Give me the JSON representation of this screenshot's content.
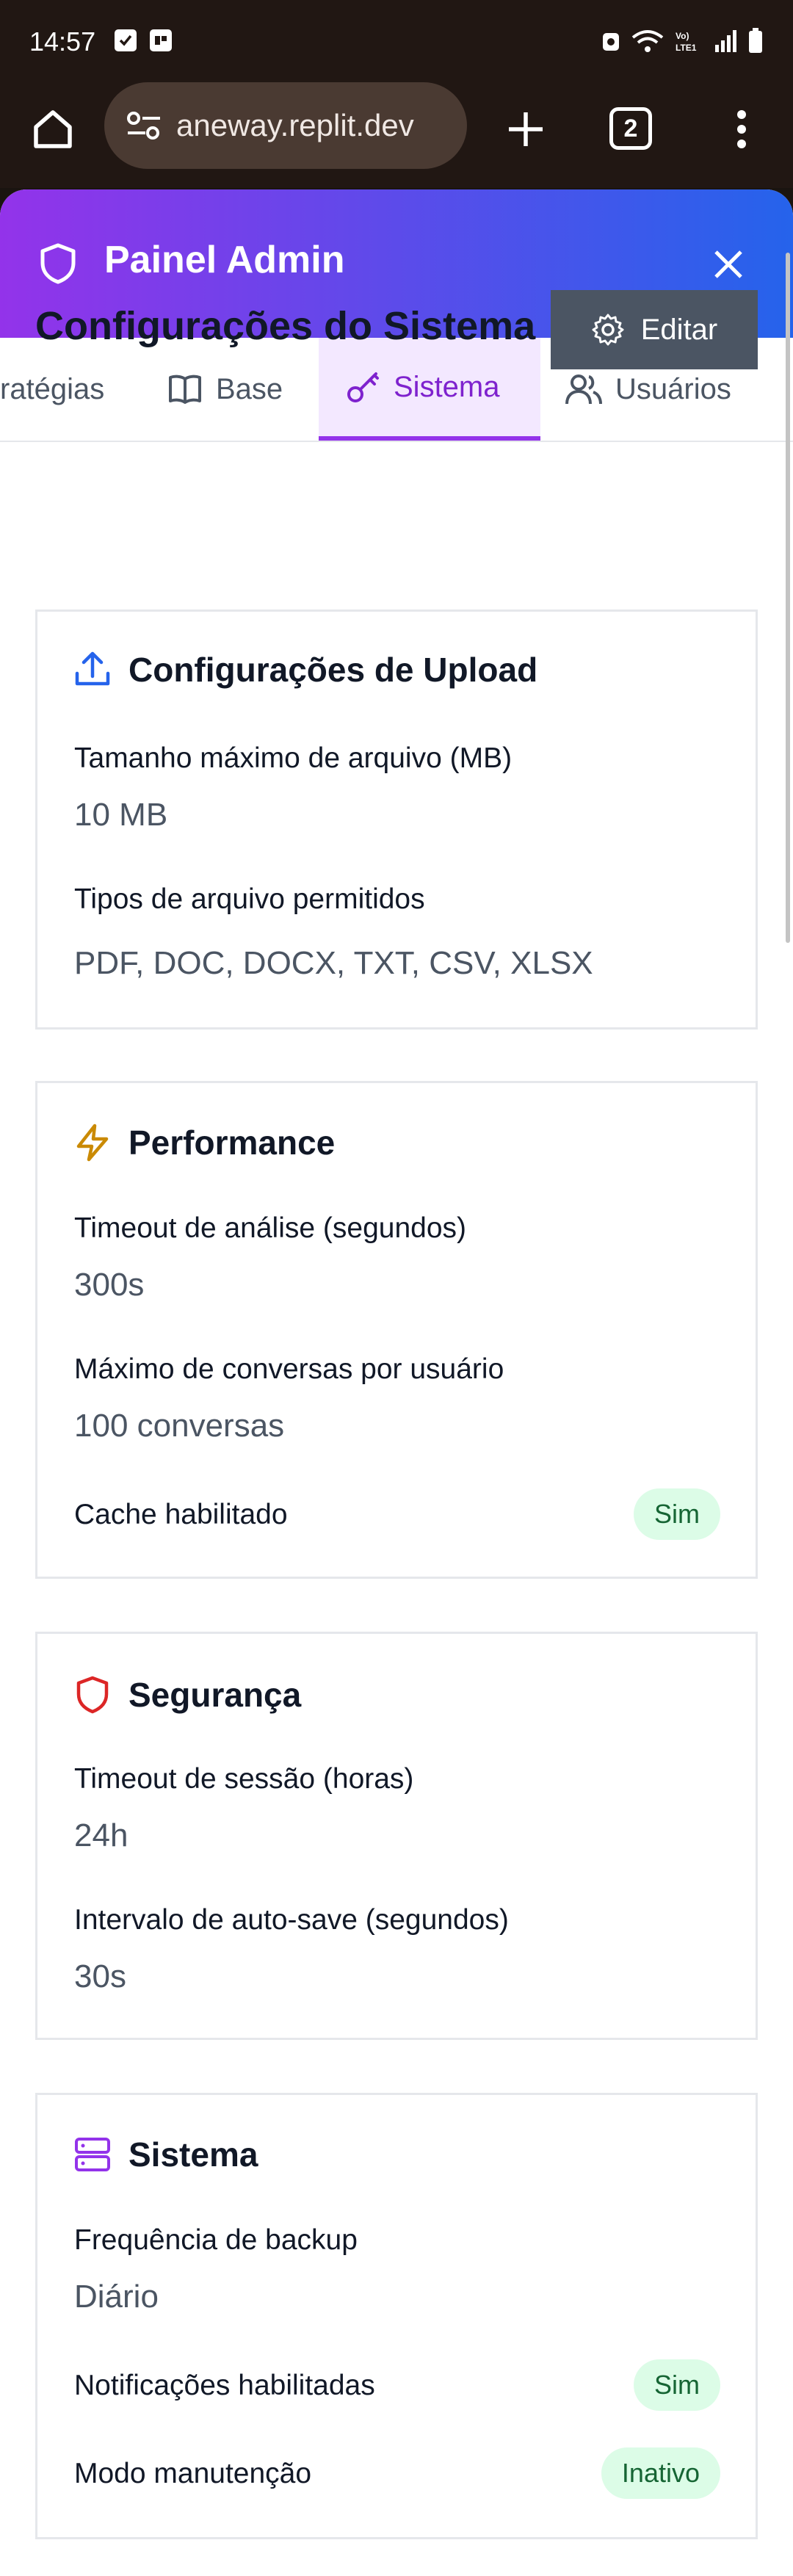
{
  "status_bar": {
    "time": "14:57"
  },
  "browser": {
    "url": "aneway.replit.dev",
    "tab_count": "2"
  },
  "modal": {
    "title": "Painel Admin",
    "tabs": [
      {
        "label": "ratégias"
      },
      {
        "label": "Base"
      },
      {
        "label": "Sistema"
      },
      {
        "label": "Usuários"
      }
    ],
    "page_title": "Configurações do Sistema",
    "edit_label": "Editar"
  },
  "cards": {
    "upload": {
      "title": "Configurações de Upload",
      "max_size_label": "Tamanho máximo de arquivo (MB)",
      "max_size_value": "10 MB",
      "types_label": "Tipos de arquivo permitidos",
      "types_value": "PDF, DOC, DOCX, TXT, CSV, XLSX"
    },
    "performance": {
      "title": "Performance",
      "timeout_label": "Timeout de análise (segundos)",
      "timeout_value": "300s",
      "max_conv_label": "Máximo de conversas por usuário",
      "max_conv_value": "100 conversas",
      "cache_label": "Cache habilitado",
      "cache_value": "Sim"
    },
    "security": {
      "title": "Segurança",
      "session_label": "Timeout de sessão (horas)",
      "session_value": "24h",
      "autosave_label": "Intervalo de auto-save (segundos)",
      "autosave_value": "30s"
    },
    "system": {
      "title": "Sistema",
      "backup_label": "Frequência de backup",
      "backup_value": "Diário",
      "notif_label": "Notificações habilitadas",
      "notif_value": "Sim",
      "maint_label": "Modo manutenção",
      "maint_value": "Inativo"
    }
  },
  "colors": {
    "header_gradient_start": "#9333ea",
    "header_gradient_end": "#2563eb",
    "active_tab": "#9333ea",
    "badge_bg": "#dcfce7",
    "badge_text": "#166534",
    "edit_button": "#4b5563"
  }
}
